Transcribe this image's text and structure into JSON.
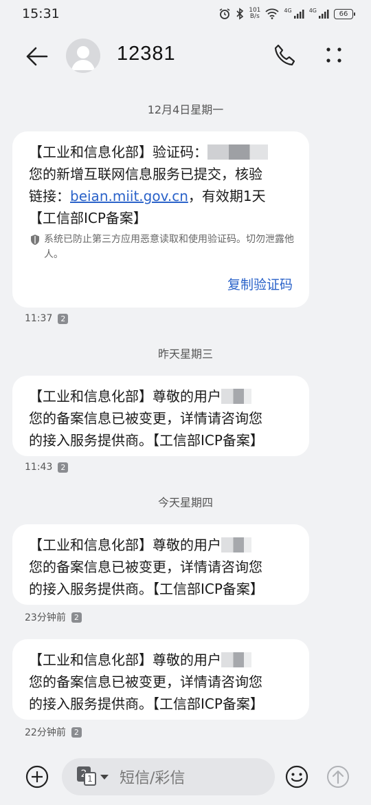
{
  "status": {
    "time": "15:31",
    "net_speed_value": "101",
    "net_speed_unit": "B/s",
    "signal_1_label": "4G",
    "signal_2_label": "4G",
    "battery": "66"
  },
  "header": {
    "contact": "12381"
  },
  "dates": [
    "12月4日星期一",
    "昨天星期三",
    "今天星期四"
  ],
  "messages": [
    {
      "line1_prefix": "【工业和信息化部】验证码：",
      "line2": "您的新增互联网信息服务已提交，核验",
      "line3_prefix": "链接：",
      "link": "beian.miit.gov.cn",
      "line3_suffix": "，有效期1天",
      "line4": "【工信部ICP备案】",
      "security_note": "系统已防止第三方应用恶意读取和使用验证码。切勿泄露他人。",
      "copy_label": "复制验证码",
      "time": "11:37",
      "sim": "2"
    },
    {
      "line1_prefix": "【工业和信息化部】尊敬的用户",
      "line2": "您的备案信息已被变更，详情请咨询您",
      "line3": "的接入服务提供商。【工信部ICP备案】",
      "time": "11:43",
      "sim": "2"
    },
    {
      "line1_prefix": "【工业和信息化部】尊敬的用户",
      "line2": "您的备案信息已被变更，详情请咨询您",
      "line3": "的接入服务提供商。【工信部ICP备案】",
      "time": "23分钟前",
      "sim": "2"
    },
    {
      "line1_prefix": "【工业和信息化部】尊敬的用户",
      "line2": "您的备案信息已被变更，详情请咨询您",
      "line3": "的接入服务提供商。【工信部ICP备案】",
      "time": "22分钟前",
      "sim": "2"
    }
  ],
  "input": {
    "placeholder": "短信/彩信",
    "sim_back": "2",
    "sim_front": "1"
  },
  "icons": {
    "back": "arrow-left-icon",
    "avatar": "person-icon",
    "call": "phone-icon",
    "more": "more-dots-icon",
    "add": "plus-circle-icon",
    "emoji": "smiley-icon",
    "send": "arrow-up-circle-icon",
    "shield": "shield-icon"
  },
  "colors": {
    "background": "#f1f2f4",
    "bubble": "#ffffff",
    "link": "#2a62c9"
  }
}
